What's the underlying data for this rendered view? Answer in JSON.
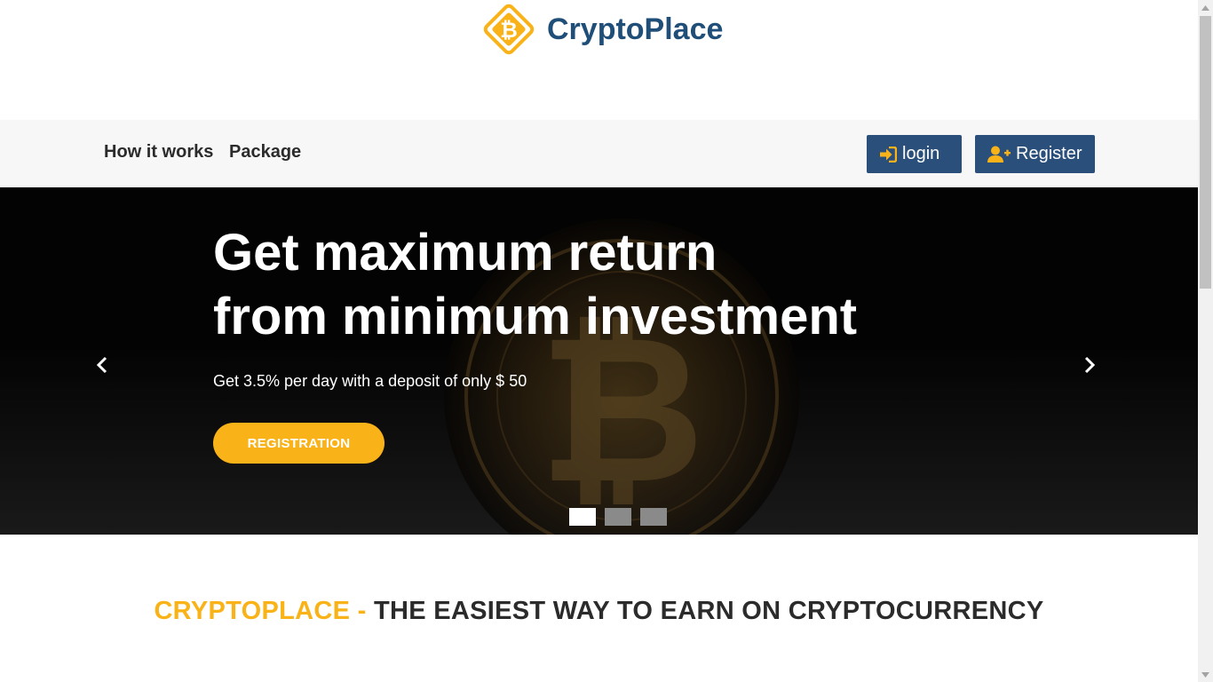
{
  "brand": {
    "name": "CryptoPlace",
    "logo_icon": "bitcoin-diamond-icon"
  },
  "nav": {
    "links": [
      {
        "label": "How it works"
      },
      {
        "label": "Package"
      }
    ],
    "login_label": "login",
    "register_label": "Register"
  },
  "hero": {
    "title_line1": "Get maximum return",
    "title_line2": "from minimum investment",
    "subtitle": "Get 3.5% per day with a deposit of only $ 50",
    "cta_label": "REGISTRATION",
    "slides_count": 3,
    "active_slide": 1
  },
  "tagline": {
    "brand": "CRYPTOPLACE - ",
    "rest": "THE EASIEST WAY TO EARN ON CRYPTOCURRENCY"
  },
  "colors": {
    "primary": "#2a4f7b",
    "accent": "#f9b319",
    "brand_text": "#1f4e79"
  }
}
